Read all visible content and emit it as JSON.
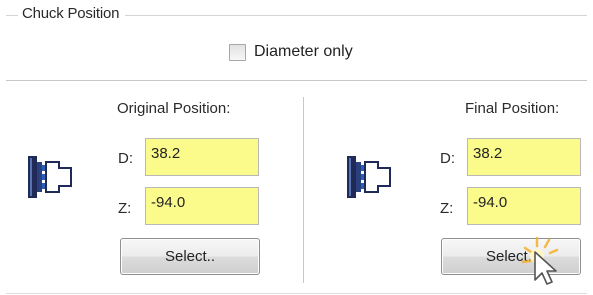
{
  "group": {
    "title": "Chuck Position"
  },
  "diameter_only": {
    "label": "Diameter only",
    "checked": false
  },
  "original": {
    "title": "Original Position:",
    "d_label": "D:",
    "d_value": "38.2",
    "z_label": "Z:",
    "z_value": "-94.0",
    "button_label": "Select.."
  },
  "final": {
    "title": "Final Position:",
    "d_label": "D:",
    "d_value": "38.2",
    "z_label": "Z:",
    "z_value": "-94.0",
    "button_label": "Select.."
  },
  "colors": {
    "field_background": "#fbfb8c",
    "chuck_icon": "#1f2a57",
    "chuck_accent": "#2e5fb8",
    "click_flash": "#f3b12a"
  },
  "icons": {
    "chuck": "chuck-icon",
    "cursor": "mouse-pointer-icon"
  }
}
